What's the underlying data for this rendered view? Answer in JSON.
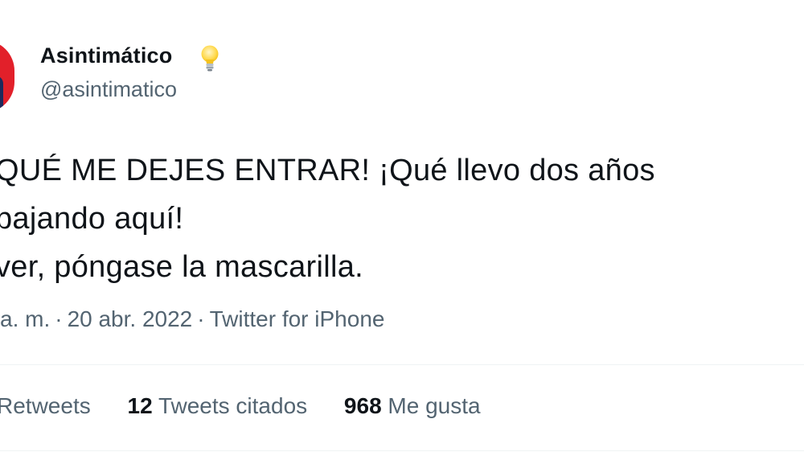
{
  "author": {
    "display_name": "Asintimático",
    "handle": "@asintimatico",
    "badge_icon": "light-bulb-icon",
    "avatar_colors": {
      "primary": "#e2202a",
      "secondary": "#1d2a5c"
    }
  },
  "tweet": {
    "lines": [
      "QUÉ ME DEJES ENTRAR! ¡Qué llevo dos años",
      "bajando aquí!",
      "ver, póngase la mascarilla."
    ],
    "time": "a. m.",
    "date": "20 abr. 2022",
    "separator": "·",
    "source": "Twitter for iPhone"
  },
  "stats": {
    "retweets": {
      "number": "",
      "label": "Retweets"
    },
    "quotes": {
      "number": "12",
      "label": "Tweets citados"
    },
    "likes": {
      "number": "968",
      "label": "Me gusta"
    }
  },
  "colors": {
    "text": "#0f1419",
    "secondary_text": "#536471",
    "divider": "#eff3f4",
    "background": "#ffffff"
  }
}
